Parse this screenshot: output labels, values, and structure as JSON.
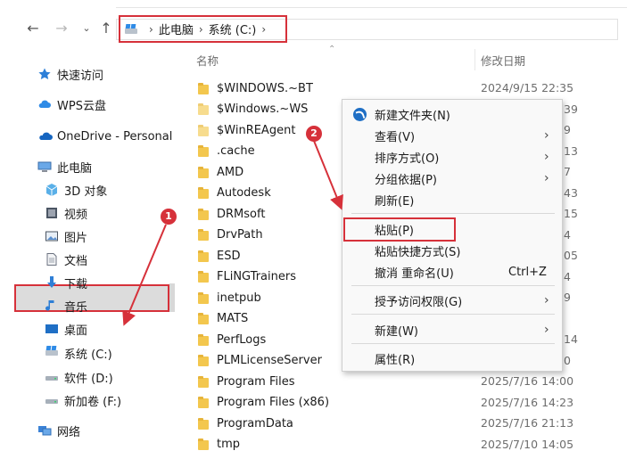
{
  "address": {
    "crumbs": [
      "此电脑",
      "系统 (C:)"
    ]
  },
  "sidebar": {
    "items": [
      {
        "label": "快速访问",
        "icon": "star-icon"
      },
      {
        "label": "WPS云盘",
        "icon": "cloud-icon"
      },
      {
        "label": "OneDrive - Personal",
        "icon": "onedrive-icon"
      },
      {
        "label": "此电脑",
        "icon": "computer-icon"
      },
      {
        "label": "3D 对象",
        "icon": "cube-icon"
      },
      {
        "label": "视频",
        "icon": "video-icon"
      },
      {
        "label": "图片",
        "icon": "picture-icon"
      },
      {
        "label": "文档",
        "icon": "document-icon"
      },
      {
        "label": "下载",
        "icon": "download-icon"
      },
      {
        "label": "音乐",
        "icon": "music-icon"
      },
      {
        "label": "桌面",
        "icon": "desktop-icon"
      },
      {
        "label": "系统 (C:)",
        "icon": "drive-icon"
      },
      {
        "label": "软件 (D:)",
        "icon": "drive-icon"
      },
      {
        "label": "新加卷 (F:)",
        "icon": "drive-icon"
      },
      {
        "label": "网络",
        "icon": "network-icon"
      }
    ]
  },
  "columns": {
    "name": "名称",
    "modified": "修改日期"
  },
  "files": [
    {
      "name": "$WINDOWS.~BT",
      "date": "2024/9/15 22:35",
      "hidden": false
    },
    {
      "name": "$Windows.~WS",
      "date": "",
      "hidden": true
    },
    {
      "name": "$WinREAgent",
      "date": "",
      "hidden": true
    },
    {
      "name": ".cache",
      "date": "",
      "hidden": false
    },
    {
      "name": "AMD",
      "date": "",
      "hidden": false
    },
    {
      "name": "Autodesk",
      "date": "",
      "hidden": false
    },
    {
      "name": "DRMsoft",
      "date": "",
      "hidden": false
    },
    {
      "name": "DrvPath",
      "date": "",
      "hidden": false
    },
    {
      "name": "ESD",
      "date": "",
      "hidden": false
    },
    {
      "name": "FLiNGTrainers",
      "date": "",
      "hidden": false
    },
    {
      "name": "inetpub",
      "date": "",
      "hidden": false
    },
    {
      "name": "MATS",
      "date": "",
      "hidden": false
    },
    {
      "name": "PerfLogs",
      "date": "",
      "hidden": false
    },
    {
      "name": "PLMLicenseServer",
      "date": "",
      "hidden": false
    },
    {
      "name": "Program Files",
      "date": "2025/7/16 14:00",
      "hidden": false
    },
    {
      "name": "Program Files (x86)",
      "date": "2025/7/16 14:23",
      "hidden": false
    },
    {
      "name": "ProgramData",
      "date": "2025/7/16 21:13",
      "hidden": false
    },
    {
      "name": "tmp",
      "date": "2025/7/10 14:05",
      "hidden": false
    }
  ],
  "partial_dates": [
    {
      "row": 1,
      "text": "39"
    },
    {
      "row": 2,
      "text": "9"
    },
    {
      "row": 3,
      "text": "13"
    },
    {
      "row": 4,
      "text": "7"
    },
    {
      "row": 5,
      "text": "43"
    },
    {
      "row": 6,
      "text": "15"
    },
    {
      "row": 7,
      "text": "4"
    },
    {
      "row": 8,
      "text": "05"
    },
    {
      "row": 9,
      "text": "4"
    },
    {
      "row": 10,
      "text": "9"
    },
    {
      "row": 12,
      "text": "14"
    },
    {
      "row": 13,
      "text": "0"
    }
  ],
  "context_menu": {
    "items": [
      {
        "label": "新建文件夹(N)",
        "arrow": false,
        "shortcut": ""
      },
      {
        "label": "查看(V)",
        "arrow": true,
        "shortcut": ""
      },
      {
        "label": "排序方式(O)",
        "arrow": true,
        "shortcut": ""
      },
      {
        "label": "分组依据(P)",
        "arrow": true,
        "shortcut": ""
      },
      {
        "label": "刷新(E)",
        "arrow": false,
        "shortcut": ""
      },
      {
        "label": "粘贴(P)",
        "arrow": false,
        "shortcut": ""
      },
      {
        "label": "粘贴快捷方式(S)",
        "arrow": false,
        "shortcut": ""
      },
      {
        "label": "撤消 重命名(U)",
        "arrow": false,
        "shortcut": "Ctrl+Z"
      },
      {
        "label": "授予访问权限(G)",
        "arrow": true,
        "shortcut": ""
      },
      {
        "label": "新建(W)",
        "arrow": true,
        "shortcut": ""
      },
      {
        "label": "属性(R)",
        "arrow": false,
        "shortcut": ""
      }
    ]
  },
  "annotations": {
    "step1": "1",
    "step2": "2"
  },
  "colors": {
    "highlight_red": "#d6313a",
    "folder_yellow": "#f3c74e",
    "accent_blue": "#1f6fc5"
  }
}
